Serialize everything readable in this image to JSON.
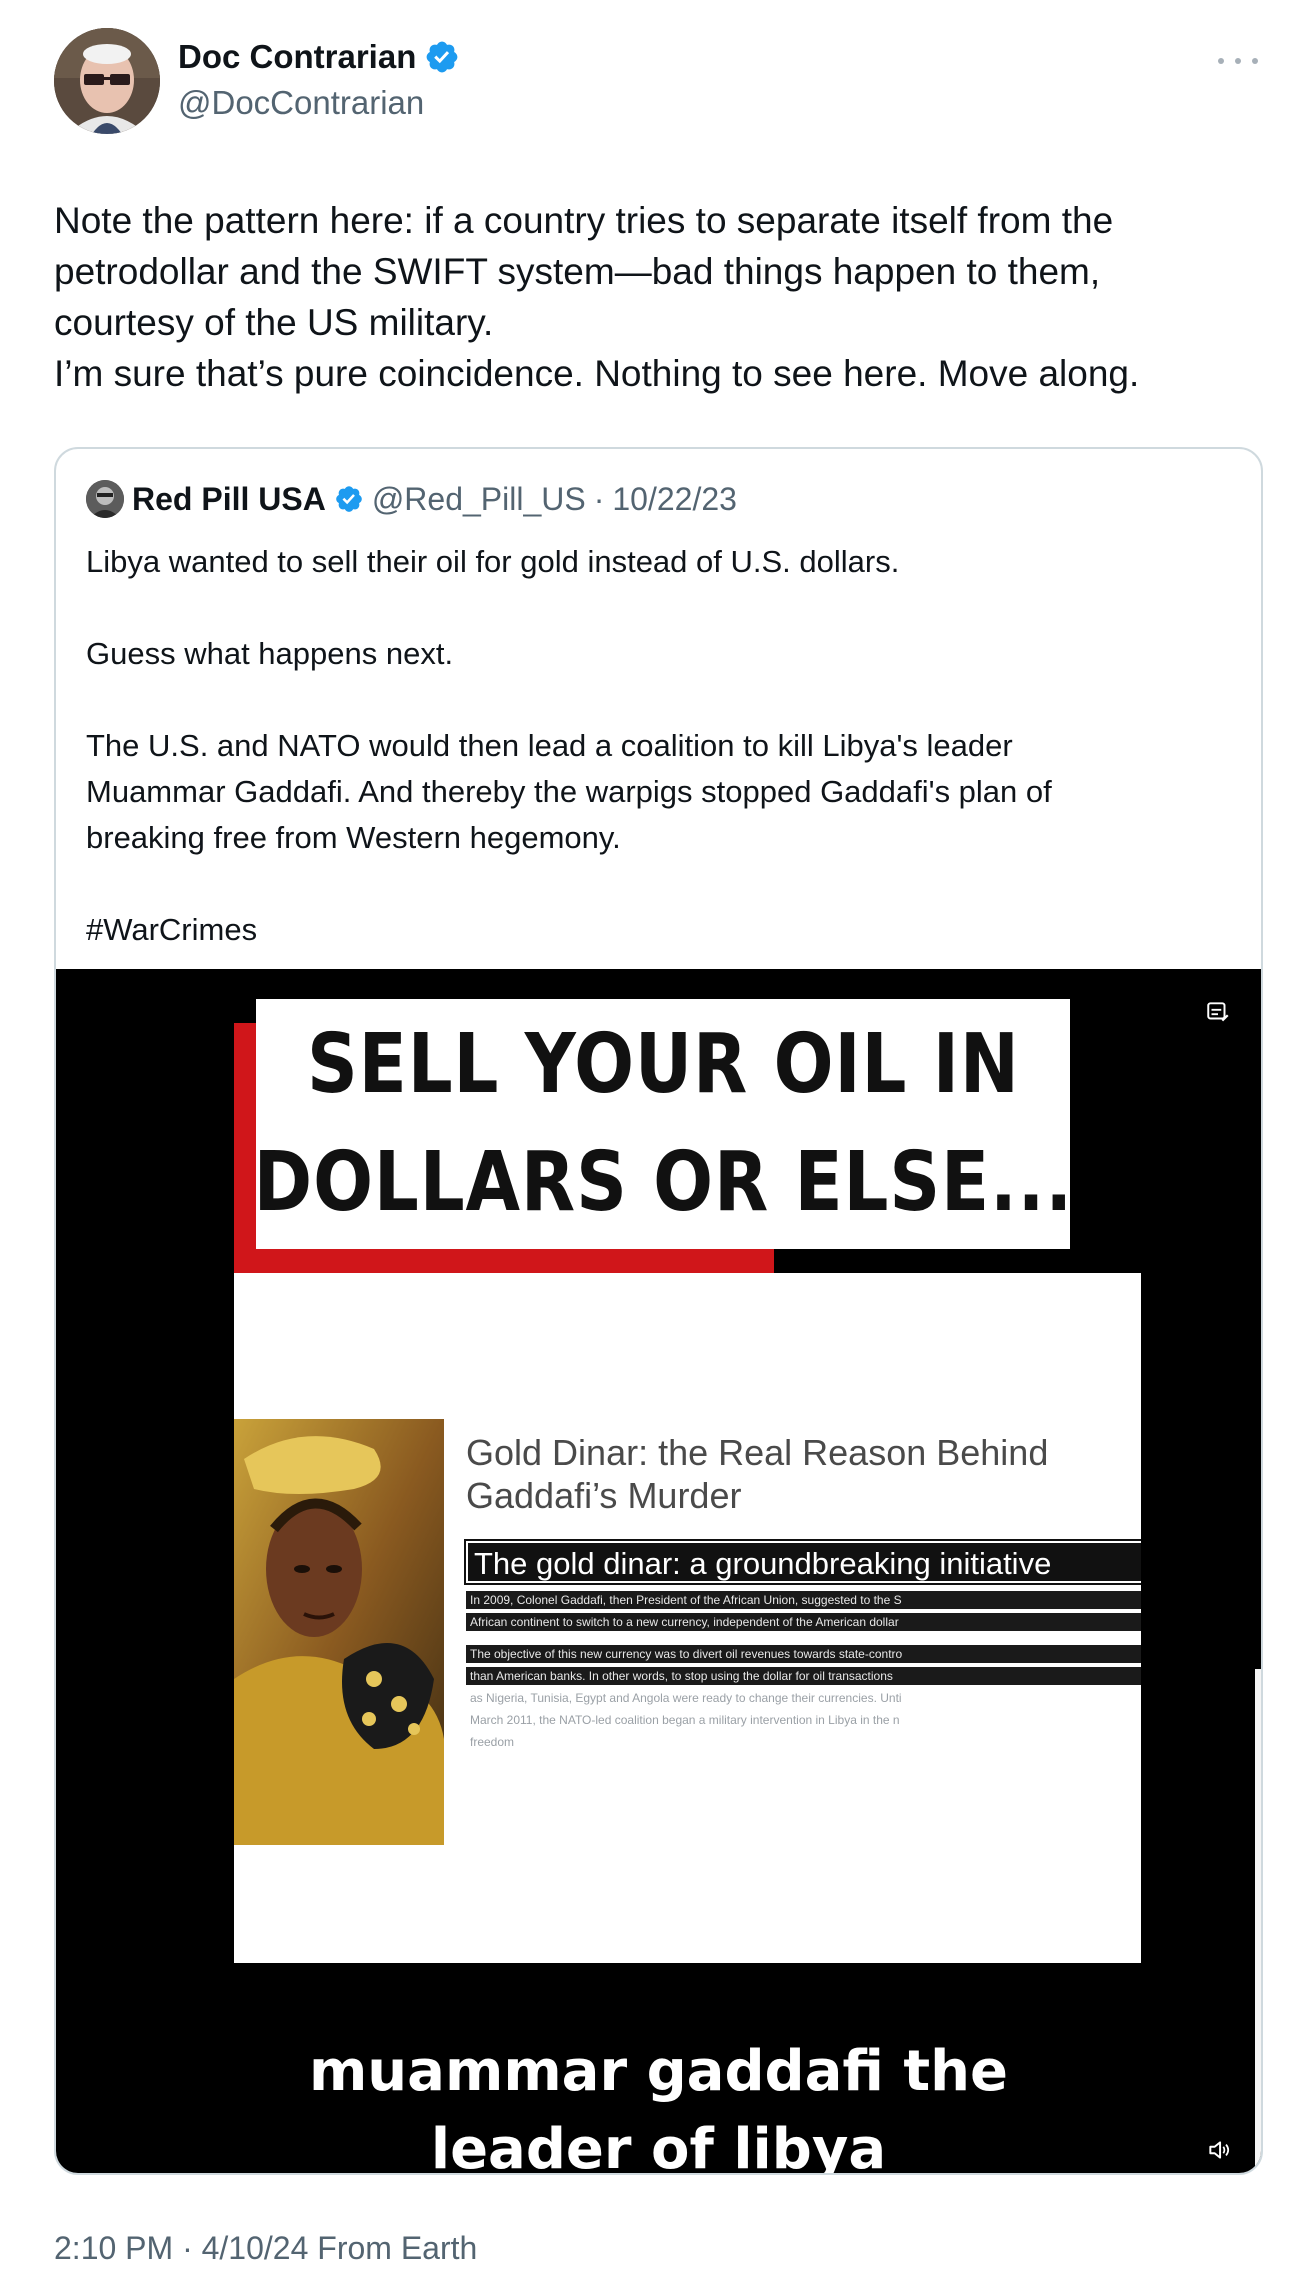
{
  "author": {
    "name": "Doc Contrarian",
    "handle": "@DocContrarian",
    "verified": true,
    "avatar_icon": "avatar-older-man-with-glasses"
  },
  "tweet": {
    "lines": [
      "Note the pattern here: if a country tries to separate itself from the",
      "petrodollar and the SWIFT system—bad things happen to them,",
      "courtesy of the US military.",
      "I’m sure that’s pure coincidence. Nothing to see here. Move along."
    ]
  },
  "quoted": {
    "name": "Red Pill USA",
    "handle": "@Red_Pill_US",
    "separator": "·",
    "date": "10/22/23",
    "paragraphs": [
      "Libya wanted to sell their oil for gold instead of U.S. dollars.",
      "",
      "Guess what happens next.",
      "",
      "The U.S. and NATO would then lead a coalition to kill Libya's leader",
      "Muammar Gaddafi.  And thereby the warpigs stopped Gaddafi's plan of",
      "breaking free from Western hegemony.",
      "",
      "#WarCrimes"
    ]
  },
  "video": {
    "headline": [
      "SELL YOUR OIL IN",
      "DOLLARS OR ELSE..."
    ],
    "article_title": [
      "Gold Dinar: the Real Reason Behind",
      "Gaddafi’s Murder"
    ],
    "section_heading": "The gold dinar: a groundbreaking initiative",
    "body_lines": [
      "In 2009, Colonel Gaddafi, then President of the African Union, suggested to the S",
      "African continent to switch to a new currency, independent of the American dollar",
      "The objective of this new currency was to divert oil revenues towards state-contro",
      "than American banks. In other words, to stop using the dollar for oil transactions",
      "as Nigeria, Tunisia, Egypt and Angola were ready to change their currencies. Unti",
      "March 2011, the NATO-led coalition began a military intervention in Libya in the n",
      "freedom"
    ],
    "caption_lines": [
      "muammar gaddafi the",
      "leader of libya"
    ],
    "colors": {
      "accent_red": "#d0161a",
      "background": "#000000"
    }
  },
  "footer": {
    "time": "2:10 PM",
    "separator": "·",
    "date": "4/10/24",
    "source": "From Earth"
  },
  "colors": {
    "verified_blue": "#1d9bf0",
    "secondary_text": "#536471",
    "border": "#cfd9de"
  }
}
